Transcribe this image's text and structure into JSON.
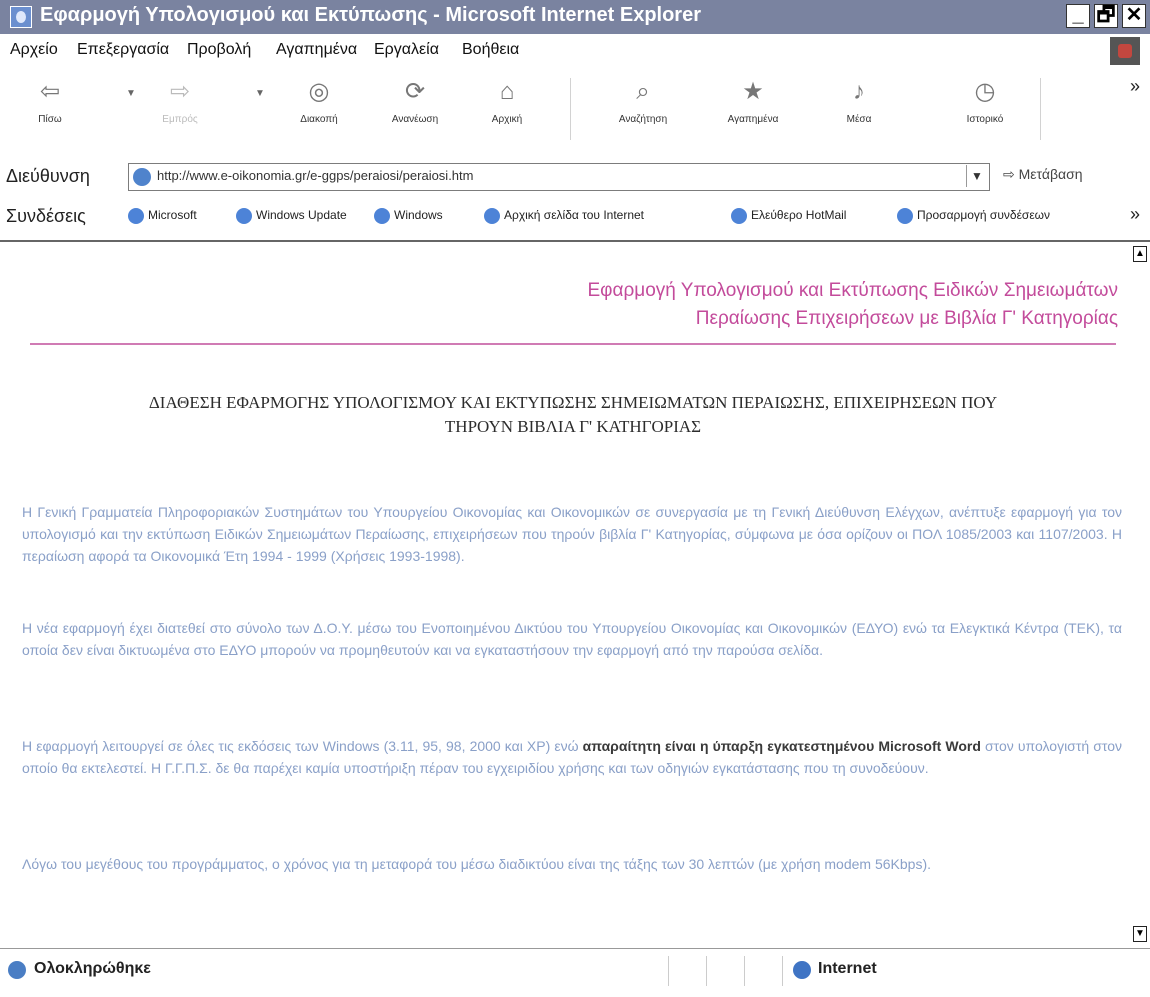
{
  "window": {
    "title": "Εφαρμογή Υπολογισμού και Εκτύπωσης - Microsoft Internet Explorer",
    "buttons": [
      "_",
      "🗗",
      "✕"
    ]
  },
  "menu": [
    "Αρχείο",
    "Επεξεργασία",
    "Προβολή",
    "Αγαπημένα",
    "Εργαλεία",
    "Βοήθεια"
  ],
  "toolbar": {
    "back": "Πίσω",
    "forward": "Εμπρός",
    "stop": "Διακοπή",
    "refresh": "Ανανέωση",
    "home": "Αρχική",
    "search": "Αναζήτηση",
    "favorites": "Αγαπημένα",
    "media": "Μέσα",
    "history": "Ιστορικό",
    "more": "»"
  },
  "address": {
    "label": "Διεύθυνση",
    "url": "http://www.e-oikonomia.gr/e-ggps/peraiosi/peraiosi.htm",
    "go": "Μετάβαση"
  },
  "links": {
    "label": "Συνδέσεις",
    "items": [
      "Microsoft",
      "Windows Update",
      "Windows",
      "Αρχική σελίδα του Internet",
      "Ελεύθερο HotMail",
      "Προσαρμογή συνδέσεων"
    ],
    "more": "»"
  },
  "content": {
    "header_line1": "Εφαρμογή Υπολογισμού και Εκτύπωσης Ειδικών Σημειωμάτων",
    "header_line2": "Περαίωσης Επιχειρήσεων με Βιβλία Γ' Κατηγορίας",
    "section_title_line1": "ΔΙΑΘΕΣΗ ΕΦΑΡΜΟΓΗΣ ΥΠΟΛΟΓΙΣΜΟΥ ΚΑΙ ΕΚΤΥΠΩΣΗΣ ΣΗΜΕΙΩΜΑΤΩΝ ΠΕΡΑΙΩΣΗΣ, ΕΠΙΧΕΙΡΗΣΕΩΝ ΠΟΥ",
    "section_title_line2": "ΤΗΡΟΥΝ ΒΙΒΛΙΑ Γ' ΚΑΤΗΓΟΡΙΑΣ",
    "p1": "Η Γενική Γραμματεία Πληροφοριακών Συστημάτων του Υπουργείου Οικονομίας και Οικονομικών σε συνεργασία με τη Γενική Διεύθυνση Ελέγχων, ανέπτυξε εφαρμογή για τον υπολογισμό και την εκτύπωση Ειδικών Σημειωμάτων Περαίωσης, επιχειρήσεων που τηρούν βιβλία Γ' Κατηγορίας, σύμφωνα με όσα ορίζουν οι ΠΟΛ 1085/2003 και 1107/2003. Η περαίωση αφορά τα Οικονομικά Έτη 1994 - 1999 (Χρήσεις 1993-1998).",
    "p2": "Η νέα εφαρμογή έχει διατεθεί στο σύνολο των Δ.Ο.Υ. μέσω του Ενοποιημένου Δικτύου του Υπουργείου Οικονομίας και Οικονομικών (ΕΔΥΟ) ενώ τα Ελεγκτικά Κέντρα (ΤΕΚ), τα οποία δεν είναι δικτυωμένα στο ΕΔΥΟ μπορούν να προμηθευτούν και να εγκαταστήσουν την εφαρμογή από την παρούσα σελίδα.",
    "p3a": "Η εφαρμογή λειτουργεί σε όλες τις εκδόσεις των Windows (3.11, 95, 98, 2000 και XP) ενώ ",
    "p3b": "απαραίτητη είναι η ύπαρξη εγκατεστημένου Microsoft Word",
    "p3c": " στον υπολογιστή στον οποίο θα εκτελεστεί. Η Γ.Γ.Π.Σ. δε θα παρέχει καμία υποστήριξη πέραν του εγχειριδίου χρήσης και των οδηγιών εγκατάστασης που τη συνοδεύουν.",
    "p4": "Λόγω του μεγέθους του προγράμματος, ο χρόνος για τη μεταφορά του μέσω διαδικτύου είναι της τάξης των 30 λεπτών (με χρήση modem 56Kbps)."
  },
  "status": {
    "text": "Ολοκληρώθηκε",
    "zone": "Internet"
  }
}
